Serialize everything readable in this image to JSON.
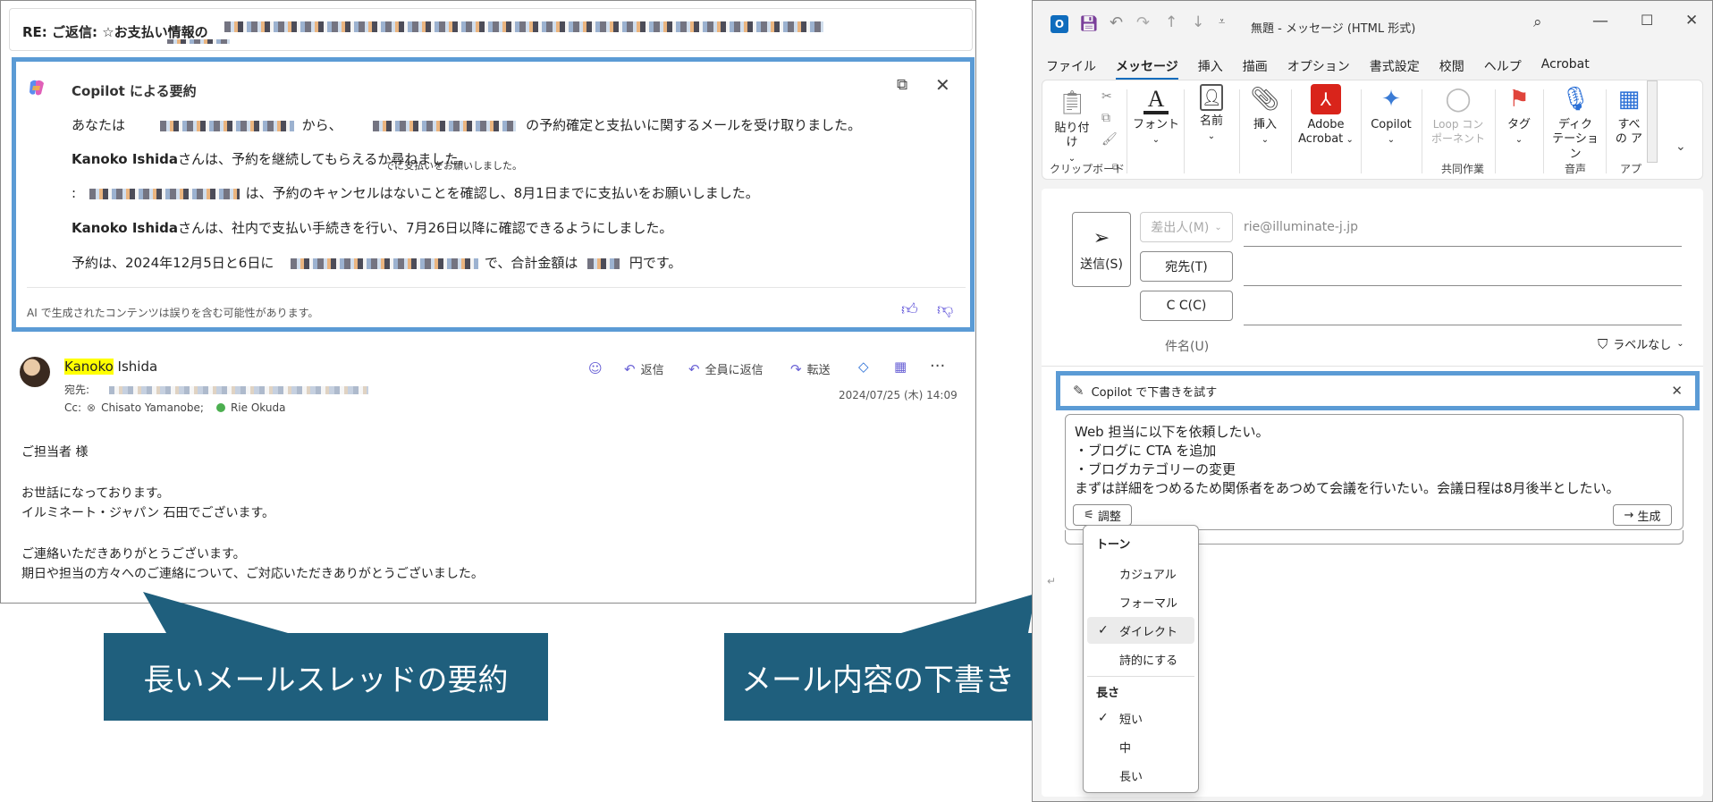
{
  "email": {
    "subject": "RE: ご返信: ☆お支払い情報の",
    "summary": {
      "title": "Copilot による要約",
      "lines": [
        {
          "a": "あなたは",
          "b": "から、",
          "c": "の予約確定と支払いに関するメールを受け取りました。"
        },
        {
          "bold": "Kanoko Ishida",
          "rest": "さんは、予約を継続してもらえるか尋ねました。",
          "tip": "でに支払いをお願いしました。"
        },
        {
          "a": ":",
          "rest": "は、予約のキャンセルはないことを確認し、8月1日までに支払いをお願いしました。"
        },
        {
          "bold": "Kanoko Ishida",
          "rest": "さんは、社内で支払い手続きを行い、7月26日以降に確認できるようにしました。"
        },
        {
          "a": "予約は、2024年12月5日と6日に",
          "b": "で、合計金額は",
          "c": "円です。"
        }
      ],
      "footer": "AI で生成されたコンテンツは誤りを含む可能性があります。"
    },
    "message": {
      "sender_first": "Kanoko",
      "sender_last": " Ishida",
      "to_label": "宛先:",
      "cc_label": "Cc:",
      "cc1": "Chisato Yamanobe;",
      "cc2": "Rie Okuda",
      "date": "2024/07/25 (木) 14:09",
      "actions": {
        "reply": "返信",
        "reply_all": "全員に返信",
        "forward": "転送"
      },
      "body": [
        "ご担当者 様",
        "お世話になっております。",
        "イルミネート・ジャパン 石田でございます。",
        "ご連絡いただきありがとうございます。",
        "期日や担当の方々へのご連絡について、ご対応いただきありがとうございました。"
      ]
    }
  },
  "callouts": {
    "left": "長いメールスレッドの要約",
    "right": "メール内容の下書き"
  },
  "outlook": {
    "title": "無題 - メッセージ (HTML 形式)",
    "menu": [
      "ファイル",
      "メッセージ",
      "挿入",
      "描画",
      "オプション",
      "書式設定",
      "校閲",
      "ヘルプ",
      "Acrobat"
    ],
    "ribbon": {
      "paste": "貼り付け",
      "font": "フォント",
      "name": "名前",
      "insert": "挿入",
      "adobe1": "Adobe",
      "adobe2": "Acrobat",
      "copilot": "Copilot",
      "loop1": "Loop コン",
      "loop2": "ポーネント",
      "tag": "タグ",
      "dictate1": "ディク",
      "dictate2": "テーション",
      "all1": "すべ",
      "all2": "の ア",
      "group_clipboard": "クリップボード",
      "group_collab": "共同作業",
      "group_voice": "音声",
      "group_app": "アプ"
    },
    "compose": {
      "send": "送信(S)",
      "from_label": "差出人(M)",
      "from_value": "rie@illuminate-j.jp",
      "to_label": "宛先(T)",
      "cc_label": "C C(C)",
      "subject_label": "件名(U)",
      "label_none": "ラベルなし",
      "draft_title": "Copilot で下書きを試す",
      "draft_lines": [
        "Web 担当に以下を依頼したい。",
        "・ブログに CTA を追加",
        "・ブログカテゴリーの変更",
        "まずは詳細をつめるため関係者をあつめて会議を行いたい。会議日程は8月後半としたい。"
      ],
      "adjust": "調整",
      "generate": "生成"
    },
    "dropdown": {
      "tone_header": "トーン",
      "tones": [
        "カジュアル",
        "フォーマル",
        "ダイレクト",
        "詩的にする"
      ],
      "length_header": "長さ",
      "lengths": [
        "短い",
        "中",
        "長い"
      ]
    }
  }
}
